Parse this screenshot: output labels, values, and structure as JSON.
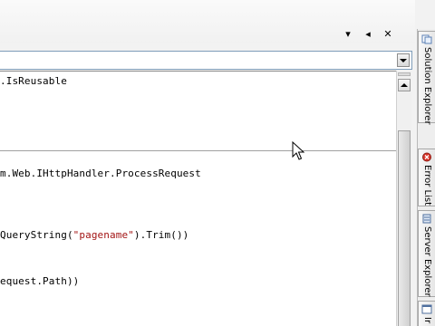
{
  "window_controls": {
    "dropdown_glyph": "▾",
    "pin_glyph": "◂",
    "close_glyph": "✕"
  },
  "member_dropdown": {
    "selected": ""
  },
  "code_lines": [
    {
      "pre": ".IsReusable",
      "str": "",
      "post": ""
    },
    {
      "pre": "m.Web.IHttpHandler.ProcessRequest",
      "str": "",
      "post": ""
    },
    {
      "pre": "QueryString(",
      "str": "\"pagename\"",
      "post": ").Trim())"
    },
    {
      "pre": "equest.Path))",
      "str": "",
      "post": ""
    }
  ],
  "dock_tabs": [
    {
      "label": "Solution Explorer",
      "icon": "solution-explorer-icon"
    },
    {
      "label": "Error List",
      "icon": "error-list-icon"
    },
    {
      "label": "Server Explorer",
      "icon": "server-explorer-icon"
    },
    {
      "label": "Ir",
      "icon": "immediate-window-icon"
    }
  ],
  "colors": {
    "string_literal": "#a31515",
    "code_text": "#000000",
    "editor_background": "#ffffff"
  }
}
